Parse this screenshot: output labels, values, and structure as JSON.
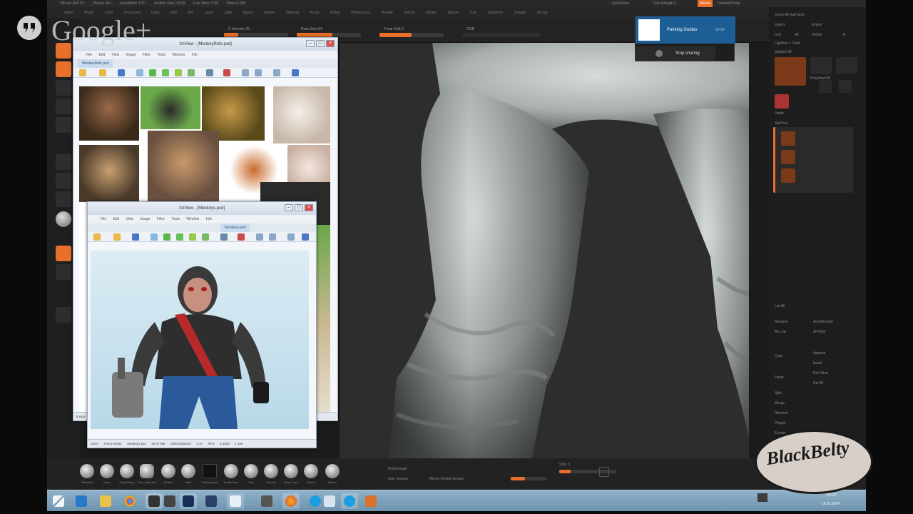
{
  "overlay": {
    "brand": "Google+"
  },
  "screen_share": {
    "presenter": "Painting Guides",
    "time": "00:00",
    "stop_label": "Stop sharing"
  },
  "zbrush": {
    "title_bar": [
      "ZBrush 4R6 P2",
      "ZBrush 4R6",
      "ActiveMem 3767",
      "Scratch Disk 12639",
      "Free Mem 7198",
      "Timer 0.008"
    ],
    "menu": [
      "Alpha",
      "Brush",
      "Color",
      "Document",
      "Draw",
      "Edit",
      "File",
      "Layer",
      "Light",
      "Macro",
      "Marker",
      "Material",
      "Movie",
      "Picker",
      "Preferences",
      "Render",
      "Stencil",
      "Stroke",
      "Texture",
      "Tool",
      "Transform",
      "Zplugin",
      "Zscript"
    ],
    "toolbar": {
      "intensity": "Z Intensity 25",
      "draw_size": "Draw Size 64",
      "focal": "Focal Shift 0",
      "rgb": "RGB",
      "quicksave": "QuickSave",
      "seethrough": "See-through 0",
      "menus": "Menus",
      "default_script": "DefaultZScript",
      "intensity_val": 0.22,
      "drawsize_val": 0.55,
      "focal_val": 0.5
    },
    "right_panel": {
      "header": "Clone  All SubTools",
      "rows": [
        "Import",
        "Export",
        "GoZ",
        "All",
        "Visible",
        "R",
        "Lightbox > Tools",
        "Subtool 96",
        "SubTool"
      ],
      "tool_labels": [
        "PolyMesh3D",
        "SimpleBrush",
        "Pants",
        "Subtool 1"
      ],
      "lower_rows": [
        "List All",
        "Rename",
        "AutoReorder",
        "All Low",
        "All High",
        "Copy",
        "Paste",
        "Append",
        "Insert",
        "Del Other",
        "Del All",
        "Split",
        "Merge",
        "Remesh",
        "Project",
        "Extract"
      ]
    },
    "bottom": {
      "brushes": [
        "Standard",
        "Move",
        "ClayBuildup",
        "Dam_Standard",
        "hPolish",
        "Inflat",
        "Pinch",
        "TrimDynamic",
        "SnakeHook",
        "Clay",
        "Smooth",
        "Move Topo",
        "Slash3",
        "Flatten"
      ],
      "subdiv": "SDiv 3",
      "merge_label": "Merge Similar Groups",
      "auto_groups": "Auto Groups",
      "polygroup": "PolyGroupIt"
    }
  },
  "xnview_back": {
    "title": "XnView - [MonkeyRefs.psd]",
    "tab": "MonkeyRefs.psd",
    "menu": [
      "File",
      "Edit",
      "View",
      "Image",
      "Filter",
      "Tools",
      "Window",
      "Info"
    ],
    "status": [
      "Image",
      "Frame 00/21",
      "MonkeyRefs.psd",
      "1600x1200x24",
      "MC"
    ]
  },
  "xnview_front": {
    "title": "XnView - [Monkeys.psd]",
    "tab": "Monkeys.psd",
    "menu": [
      "File",
      "Edit",
      "View",
      "Image",
      "Filter",
      "Tools",
      "Window",
      "Info"
    ],
    "status": [
      "16/27",
      "Frame 00/21",
      "Monkeys.psd",
      "36.07 MB",
      "1000x2000x24",
      "1.47",
      "RPS",
      "0.3636",
      "1.159"
    ]
  },
  "taskbar": {
    "tray_time": "19:27",
    "tray_date": "16.01.2014",
    "apps": [
      "start",
      "ie",
      "explorer",
      "chrome",
      "zbrush",
      "zbrush2",
      "photoshop",
      "ps-alt",
      "xnview",
      "pen",
      "firefox",
      "skype",
      "xnview2",
      "skype2",
      "fox"
    ]
  },
  "watermark": {
    "text": "BlackBelty"
  },
  "colors": {
    "accent": "#e8702a",
    "taskbar": "#7fa3bd",
    "share_blue": "#1e5e96"
  }
}
